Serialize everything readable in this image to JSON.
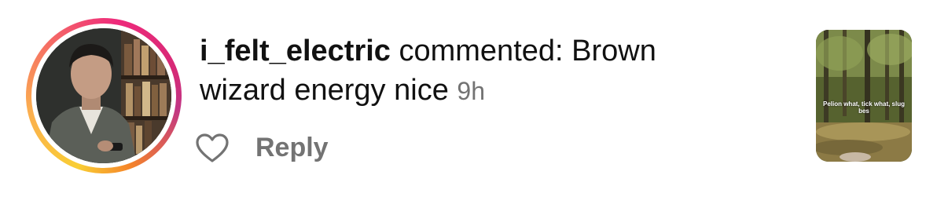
{
  "comment": {
    "username": "i_felt_electric",
    "verb": " commented: ",
    "text": "Brown wizard energy nice",
    "timestamp": "9h"
  },
  "actions": {
    "like_icon": "heart-outline-icon",
    "reply_label": "Reply"
  },
  "avatar": {
    "has_story_ring": true,
    "ring_colors": [
      "#f9ce34",
      "#ee2a7b",
      "#c13584",
      "#f58529"
    ]
  },
  "thumbnail": {
    "caption": "Pelion what, tick what, slug bes"
  },
  "colors": {
    "text": "#111111",
    "secondary": "#737373",
    "background": "#ffffff"
  }
}
